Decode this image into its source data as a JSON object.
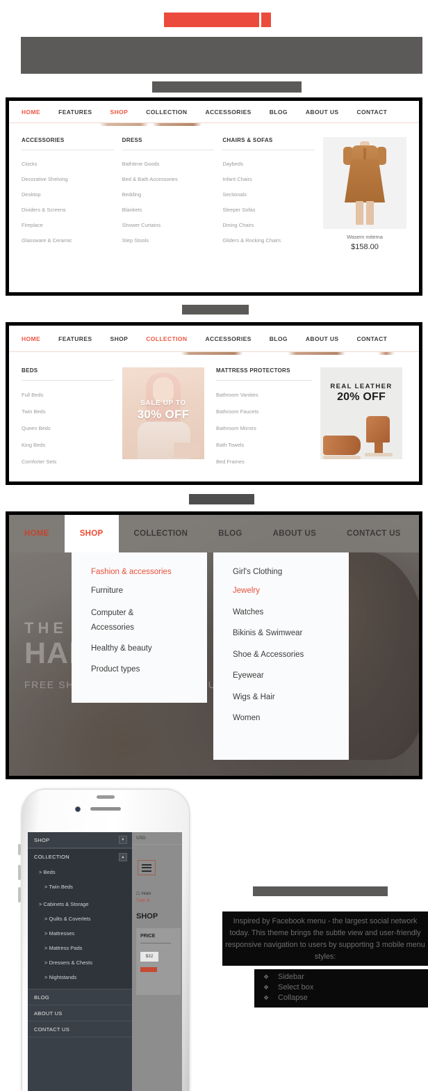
{
  "placeholders": {
    "red_bar_1": "",
    "red_bar_2": "",
    "gray_bar_headline": "",
    "gray_bar_sub": "",
    "gray_bar_sec2": "",
    "gray_bar_sec3": "",
    "gray_bar_mobile": ""
  },
  "colors": {
    "accent_red": "#ed5542",
    "placeholder_red": "#eb4b3c",
    "placeholder_gray": "#5c5a58",
    "dark_panel": "#3a4047",
    "hero_nav": "#807c78"
  },
  "section_shop": {
    "nav": [
      {
        "label": "HOME",
        "active": true
      },
      {
        "label": "FEATURES",
        "active": false
      },
      {
        "label": "SHOP",
        "active": true
      },
      {
        "label": "COLLECTION",
        "active": false
      },
      {
        "label": "ACCESSORIES",
        "active": false
      },
      {
        "label": "BLOG",
        "active": false
      },
      {
        "label": "ABOUT US",
        "active": false
      },
      {
        "label": "CONTACT",
        "active": false
      }
    ],
    "columns": [
      {
        "title": "ACCESSORIES",
        "links": [
          "Clocks",
          "Decorative Shelving",
          "Desktop",
          "Dividers & Screens",
          "Fireplace",
          "Glassware & Ceramic"
        ]
      },
      {
        "title": "DRESS",
        "links": [
          "Bathtime Goods",
          "Bed & Bath Accessories",
          "Bedding",
          "Blankets",
          "Shower Curtains",
          "Step Stools"
        ]
      },
      {
        "title": "CHAIRS & SOFAS",
        "links": [
          "Daybeds",
          "Infant Chairs",
          "Sectionals",
          "Sleeper Sofas",
          "Dining Chairs",
          "Gliders & Rocking Chairs"
        ]
      }
    ],
    "product": {
      "name": "Wasem mitema",
      "price": "$158.00",
      "image_alt": "tan-suede-dress-photo"
    }
  },
  "section_collection": {
    "nav": [
      {
        "label": "HOME",
        "active": true
      },
      {
        "label": "FEATURES",
        "active": false
      },
      {
        "label": "SHOP",
        "active": false
      },
      {
        "label": "COLLECTION",
        "active": true
      },
      {
        "label": "ACCESSORIES",
        "active": false
      },
      {
        "label": "BLOG",
        "active": false
      },
      {
        "label": "ABOUT US",
        "active": false
      },
      {
        "label": "CONTACT",
        "active": false
      }
    ],
    "columns": [
      {
        "title": "BEDS",
        "links": [
          "Full Beds",
          "Twin Beds",
          "Queen Beds",
          "King Beds",
          "Comforter Sets"
        ]
      },
      {
        "title": "MATTRESS PROTECTORS",
        "links": [
          "Bathroom Vanities",
          "Bathroom Faucets",
          "Bathroom Mirrors",
          "Bath Towels",
          "Bed Frames"
        ]
      }
    ],
    "promo_sale": {
      "line1": "SALE UP TO",
      "line2": "30% OFF",
      "image_alt": "pink-hair-model-photo"
    },
    "promo_leather": {
      "line1": "REAL LEATHER",
      "line2": "20% OFF",
      "image_alt": "brown-ankle-boots-photo"
    }
  },
  "section_dropdown": {
    "nav": [
      {
        "label": "HOME",
        "state": "red"
      },
      {
        "label": "SHOP",
        "state": "open"
      },
      {
        "label": "COLLECTION",
        "state": "normal"
      },
      {
        "label": "BLOG",
        "state": "normal"
      },
      {
        "label": "ABOUT US",
        "state": "normal"
      },
      {
        "label": "CONTACT US",
        "state": "normal"
      }
    ],
    "hero": {
      "line1": "THE",
      "line2": "HANDBAGS",
      "line3": "FREE SHIPPING FOR THIS PRODUCT"
    },
    "level1": [
      {
        "label": "Fashion & accessories",
        "active": true
      },
      {
        "label": "Furniture",
        "active": false
      },
      {
        "label": "Computer & Accessories",
        "active": false
      },
      {
        "label": "Healthy & beauty",
        "active": false
      },
      {
        "label": "Product types",
        "active": false
      }
    ],
    "level2": [
      {
        "label": "Girl's Clothing",
        "active": false
      },
      {
        "label": "Jewelry",
        "active": true
      },
      {
        "label": "Watches",
        "active": false
      },
      {
        "label": "Bikinis & Swimwear",
        "active": false
      },
      {
        "label": "Shoe & Accessories",
        "active": false
      },
      {
        "label": "Eyewear",
        "active": false
      },
      {
        "label": "Wigs & Hair",
        "active": false
      },
      {
        "label": "Women",
        "active": false
      }
    ]
  },
  "mobile": {
    "sidebar": {
      "shop": {
        "label": "SHOP",
        "caret": "chevron-down"
      },
      "collection": {
        "label": "COLLECTION",
        "caret": "chevron-up"
      },
      "sub_items": [
        {
          "label": "Beds",
          "level": 1
        },
        {
          "label": "Twin Beds",
          "level": 2
        },
        {
          "label": "Cabinets & Storage",
          "level": 1
        },
        {
          "label": "Quilts & Coverlets",
          "level": 2
        },
        {
          "label": "Mattresses",
          "level": 2
        },
        {
          "label": "Mattress Pads",
          "level": 2
        },
        {
          "label": "Dressers & Chests",
          "level": 2
        },
        {
          "label": "Nightstands",
          "level": 2
        }
      ],
      "bottom_items": [
        "BLOG",
        "ABOUT US",
        "CONTACT US"
      ]
    },
    "content": {
      "currency": "USD",
      "breadcrumb_home": "Hom",
      "breadcrumb_current": "Twin B",
      "heading": "SHOP",
      "filter_title": "PRICE",
      "price_chip": "$32"
    }
  },
  "copy": {
    "paragraph": "Inspired by Facebook menu - the largest social network today. This theme brings the subtle view and user-friendly responsive navigation to users by supporting 3 mobile menu styles:",
    "bullet_glyph": "❖",
    "bullets": [
      "Sidebar",
      "Select box",
      "Collapse"
    ]
  }
}
